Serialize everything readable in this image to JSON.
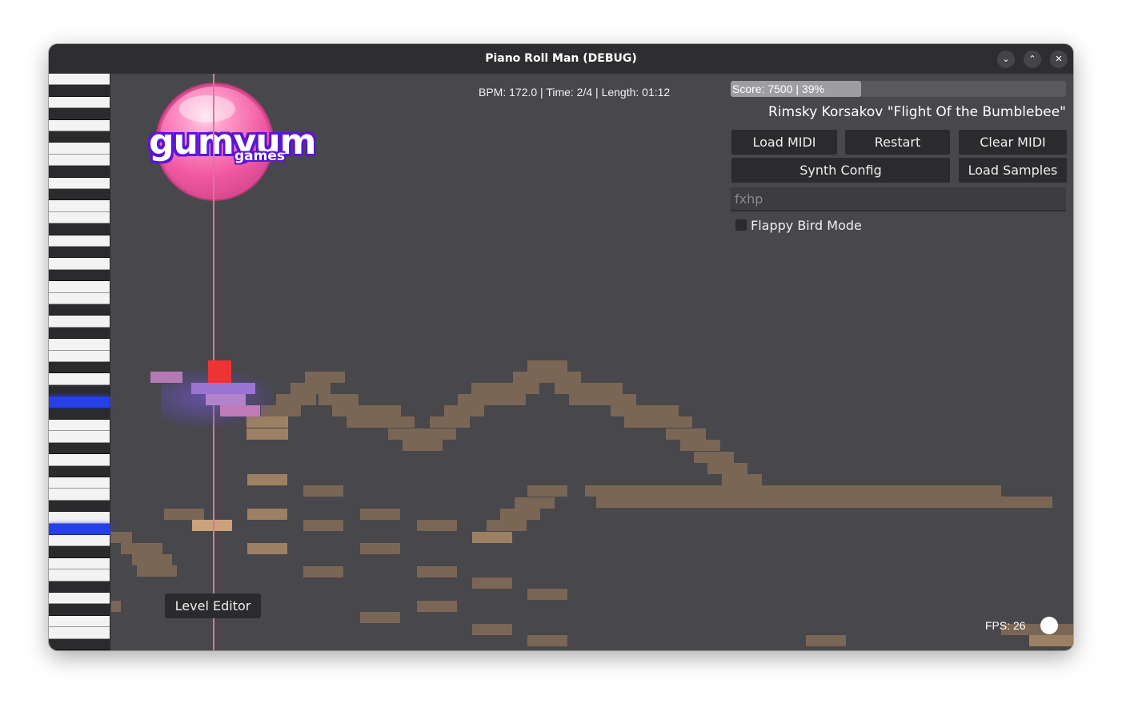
{
  "window": {
    "title": "Piano Roll Man (DEBUG)",
    "controls": {
      "minimize_icon": "chevron-down-icon",
      "maximize_icon": "chevron-up-icon",
      "close_icon": "close-icon"
    }
  },
  "hud": {
    "info": "BPM: 172.0 | Time: 2/4 | Length: 01:12",
    "score_text": "Score: 7500 | 39%",
    "score_progress": 0.39,
    "song_title": "Rimsky Korsakov \"Flight Of the Bumblebee\"",
    "fps": "FPS: 26"
  },
  "logo": {
    "text": "gumyum",
    "sub": "games"
  },
  "buttons": {
    "load_midi": "Load MIDI",
    "restart": "Restart",
    "clear_midi": "Clear MIDI",
    "synth_config": "Synth Config",
    "load_samples": "Load Samples",
    "level_editor": "Level Editor"
  },
  "input": {
    "value": "fxhp"
  },
  "checkbox": {
    "label": "Flappy Bird Mode",
    "checked": false
  },
  "colors": {
    "note": "#7a6655",
    "note_light": "#9c8064",
    "note_highlight": "#caa27c",
    "active_key": "#2640e8",
    "player": "#ee3333",
    "playhead": "#d77893"
  }
}
